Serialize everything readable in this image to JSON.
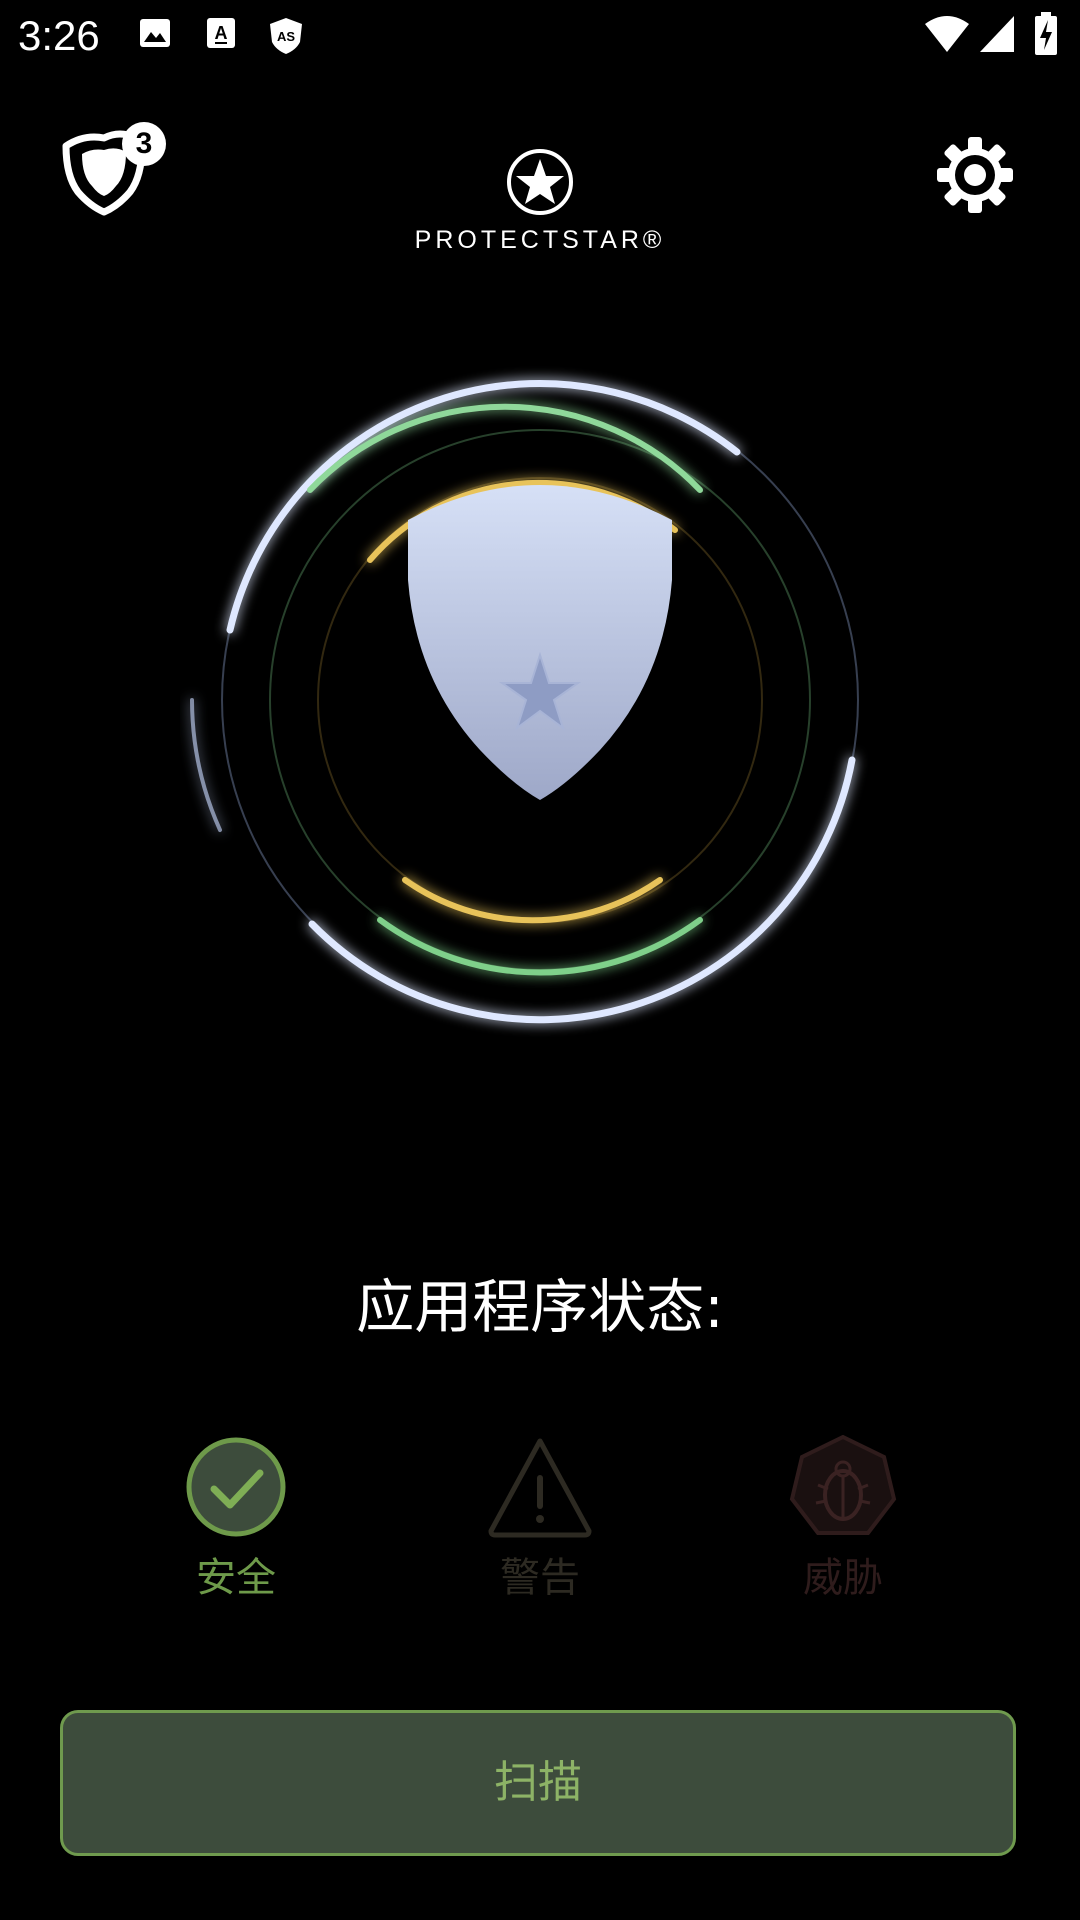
{
  "status_bar": {
    "time": "3:26",
    "left_icons": [
      "image-icon",
      "text-a-icon",
      "as-shield-icon"
    ],
    "right_icons": [
      "wifi-icon",
      "cell-signal-icon",
      "battery-charging-icon"
    ]
  },
  "header": {
    "protection_badge_count": "3",
    "logo_text": "PROTECTSTAR®"
  },
  "main": {
    "status_title": "应用程序状态:",
    "indicators": [
      {
        "label": "安全",
        "icon": "check-circle-icon",
        "color": "#6e9a4a",
        "active": true
      },
      {
        "label": "警告",
        "icon": "warning-triangle-icon",
        "color": "#2d2a22",
        "active": false
      },
      {
        "label": "威胁",
        "icon": "bug-heptagon-icon",
        "color": "#2f1c1c",
        "active": false
      }
    ]
  },
  "scan_button": {
    "label": "扫描"
  },
  "colors": {
    "accent_green": "#6f9a4e",
    "button_bg": "#3d4c3c",
    "ring_blue": "#c9d8ff",
    "ring_green": "#7fd08a",
    "ring_gold": "#e0b850"
  }
}
